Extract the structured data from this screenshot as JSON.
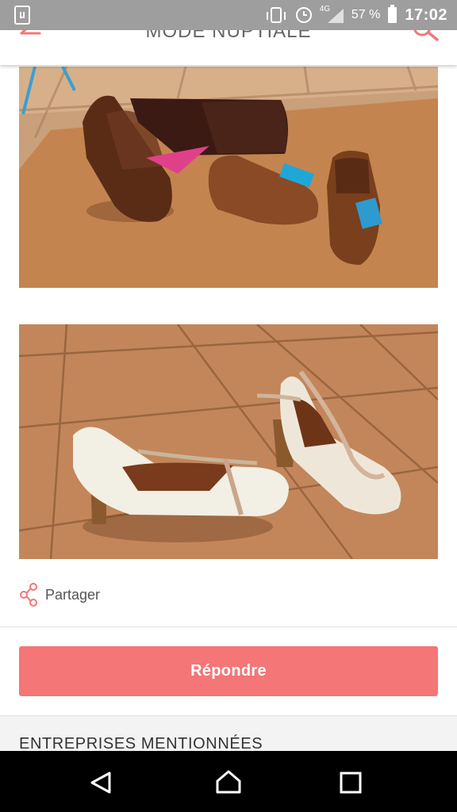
{
  "status_bar": {
    "network_label": "4G",
    "battery_percent": "57 %",
    "time": "17:02",
    "icons": [
      "screenshot-icon",
      "vibrate-icon",
      "alarm-icon",
      "signal-icon",
      "battery-icon"
    ]
  },
  "header": {
    "title": "MODE NUPTIALE",
    "back_icon": "arrow-left-icon",
    "search_icon": "search-icon"
  },
  "photos": [
    {
      "subject": "men's brown leather shoes"
    },
    {
      "subject": "women's ivory t-strap heeled shoes"
    }
  ],
  "share": {
    "label": "Partager",
    "icon": "share-icon"
  },
  "reply_button": {
    "label": "Répondre"
  },
  "companies": {
    "heading": "ENTREPRISES MENTIONNÉES"
  },
  "nav_bar": {
    "icons": [
      "back-triangle-icon",
      "home-icon",
      "recent-apps-icon"
    ]
  },
  "colors": {
    "accent": "#f47676",
    "status_bar": "#9e9e9e",
    "nav_bar": "#000000"
  }
}
